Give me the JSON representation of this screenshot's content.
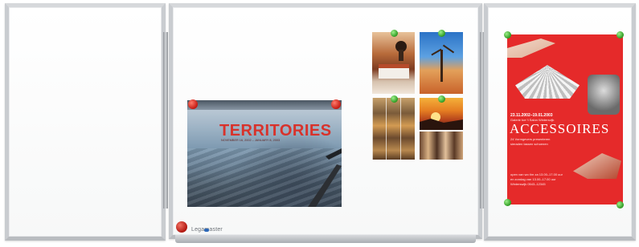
{
  "scene": {
    "description_free": true,
    "brand": "Legamaster",
    "colors": {
      "frame": "#c9ccd0",
      "board": "#ffffff",
      "red_magnet": "#c41a12",
      "green_magnet": "#2e9a22",
      "poster_red": "#e52a2a"
    }
  },
  "territories_poster": {
    "title": "TERRITORIES",
    "subtitle": "NOVEMBER 16, 2002 – JANUARY 8, 2003"
  },
  "accessoires_poster": {
    "date_line": "23.11.2002–19.01.2003",
    "subtitle": "Galerie toe 't Salon Wintersvijk",
    "title": "ACCESSOIRES",
    "line1": "24 Vormgevers presenteren",
    "line2": "sieraden tassen schoenen",
    "small1": "open van wo t/m za 13.00–17.00 uur",
    "small2": "en zondag van 13.00–17.00 uur",
    "small3": "Winterswijk 0543–12345"
  }
}
